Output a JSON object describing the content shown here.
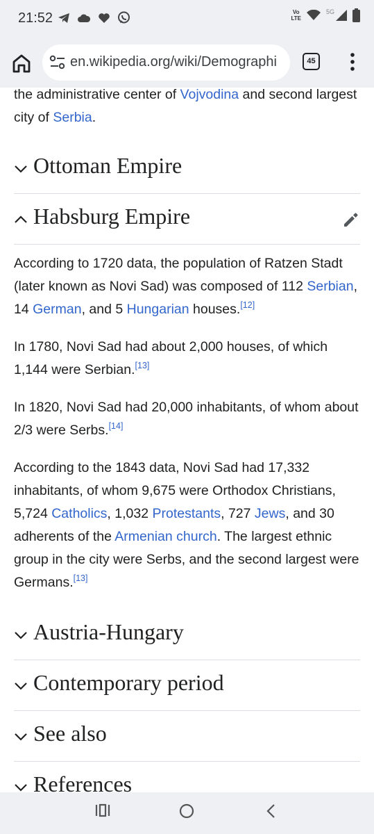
{
  "status": {
    "time": "21:52",
    "volte_line1": "Vo",
    "volte_line2": "LTE",
    "network": "5G"
  },
  "browser": {
    "url": "en.wikipedia.org/wiki/Demographi",
    "tab_count": "45"
  },
  "article": {
    "intro": {
      "t1": "the administrative center of ",
      "link1": "Vojvodina",
      "t2": " and second largest city of ",
      "link2": "Serbia",
      "t3": "."
    },
    "sections": [
      {
        "title": "Ottoman Empire",
        "expanded": false
      },
      {
        "title": "Habsburg Empire",
        "expanded": true
      },
      {
        "title": "Austria-Hungary",
        "expanded": false
      },
      {
        "title": "Contemporary period",
        "expanded": false
      },
      {
        "title": "See also",
        "expanded": false
      },
      {
        "title": "References",
        "expanded": false
      }
    ],
    "p1": {
      "t1": "According to 1720 data, the population of Ratzen Stadt (later known as Novi Sad) was composed of 112 ",
      "link1": "Serbian",
      "t2": ", 14 ",
      "link2": "German",
      "t3": ", and 5 ",
      "link3": "Hungarian",
      "t4": " houses.",
      "ref": "[12]"
    },
    "p2": {
      "t1": "In 1780, Novi Sad had about 2,000 houses, of which 1,144 were Serbian.",
      "ref": "[13]"
    },
    "p3": {
      "t1": "In 1820, Novi Sad had 20,000 inhabitants, of whom about 2/3 were Serbs.",
      "ref": "[14]"
    },
    "p4": {
      "t1": "According to the 1843 data, Novi Sad had 17,332 inhabitants, of whom 9,675 were Orthodox Christians, 5,724 ",
      "link1": "Catholics",
      "t2": ", 1,032 ",
      "link2": "Protestants",
      "t3": ", 727 ",
      "link3": "Jews",
      "t4": ", and 30 adherents of the ",
      "link4": "Armenian church",
      "t5": ". The largest ethnic group in the city were Serbs, and the second largest were Germans.",
      "ref": "[13]"
    }
  },
  "colors": {
    "link": "#3366cc",
    "text": "#202122",
    "chrome_bg": "#eef0f3",
    "divider": "#dadde1"
  },
  "icons": [
    "telegram-icon",
    "cloud-icon",
    "heart-icon",
    "viber-icon",
    "wifi-icon",
    "signal-icon",
    "battery-icon",
    "home-icon",
    "site-settings-icon",
    "tabs-icon",
    "more-menu-icon",
    "chevron-down-icon",
    "chevron-up-icon",
    "edit-pencil-icon",
    "recent-apps-icon",
    "home-circle-icon",
    "back-icon"
  ]
}
